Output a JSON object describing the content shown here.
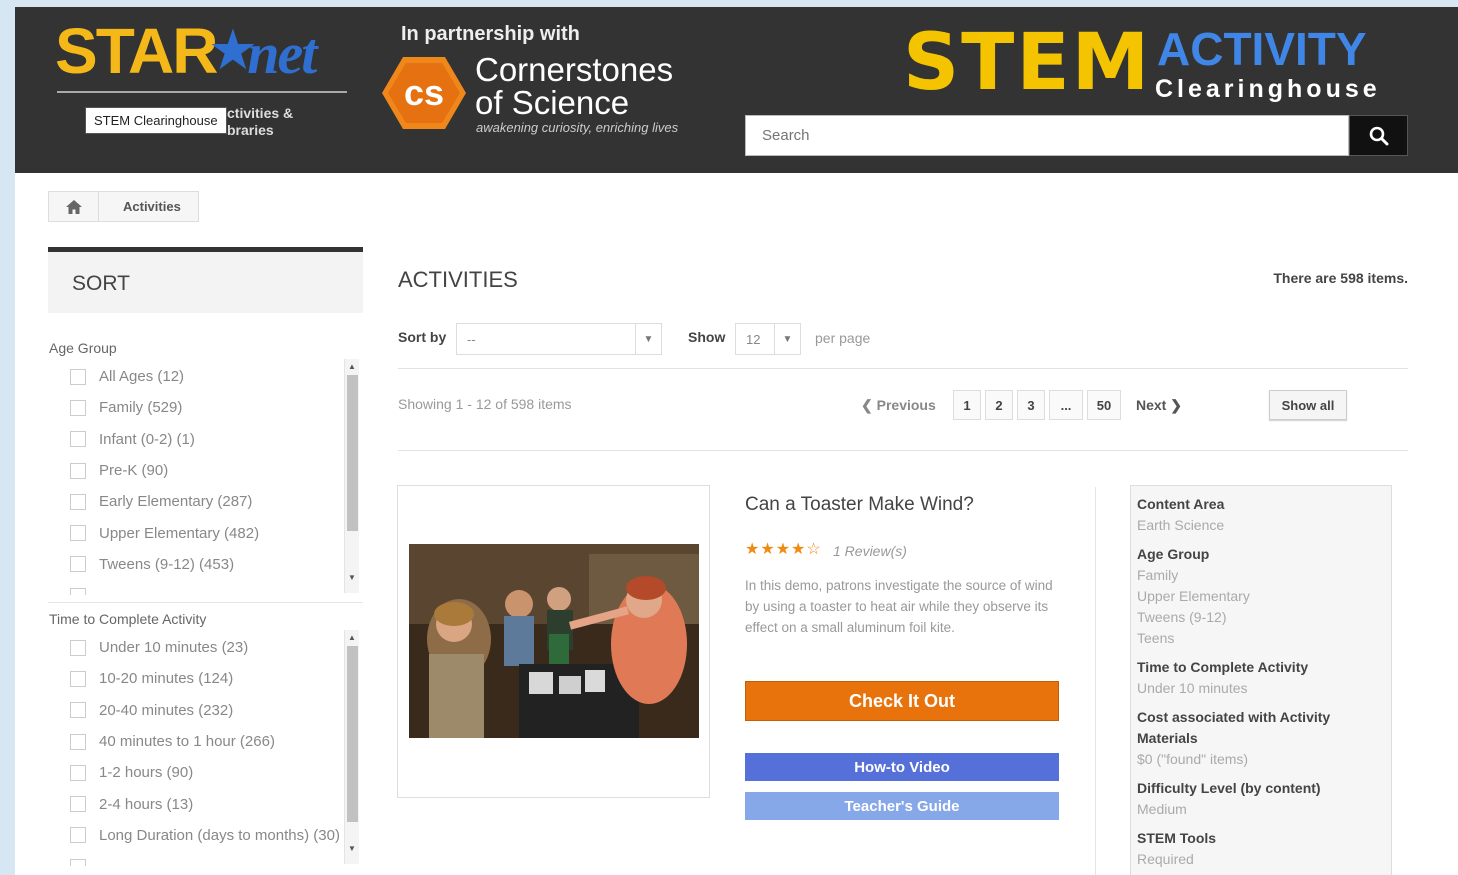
{
  "header": {
    "logo": {
      "star": "STAR",
      "net": "net"
    },
    "tooltip": "STEM Clearinghouse",
    "logo_sub_line1": "ctivities &",
    "logo_sub_line2": "braries",
    "partnership": "In partnership with",
    "cs_badge": "cs",
    "cs_line1": "Cornerstones",
    "cs_line2": "of Science",
    "cs_tagline": "awakening curiosity, enriching lives",
    "stem": "STEM",
    "activity": "ACTIVITY",
    "clearinghouse": "Clearinghouse",
    "search_placeholder": "Search"
  },
  "breadcrumb": {
    "label": "Activities"
  },
  "sort_panel": {
    "title": "SORT"
  },
  "facets": {
    "age_group": {
      "title": "Age Group",
      "items": [
        "All Ages (12)",
        "Family (529)",
        "Infant (0-2) (1)",
        "Pre-K (90)",
        "Early Elementary (287)",
        "Upper Elementary (482)",
        "Tweens (9-12) (453)"
      ]
    },
    "time": {
      "title": "Time to Complete Activity",
      "items": [
        "Under 10 minutes (23)",
        "10-20 minutes (124)",
        "20-40 minutes (232)",
        "40 minutes to 1 hour (266)",
        "1-2 hours (90)",
        "2-4 hours (13)",
        "Long Duration (days to months) (30)"
      ]
    }
  },
  "main": {
    "title": "ACTIVITIES",
    "items_count": "There are 598 items.",
    "sort_by_label": "Sort by",
    "sort_by_value": "--",
    "show_label": "Show",
    "show_value": "12",
    "per_page": "per page",
    "showing": "Showing 1 - 12 of 598 items",
    "previous": "Previous",
    "pages": [
      "1",
      "2",
      "3",
      "...",
      "50"
    ],
    "next": "Next",
    "show_all": "Show all"
  },
  "product": {
    "title": "Can a Toaster Make Wind?",
    "rating": 4,
    "stars": "★★★★☆",
    "reviews": "1 Review(s)",
    "description": "In this demo, patrons investigate the source of wind by using a toaster to heat air while they observe its effect on a small aluminum foil kite.",
    "check_label": "Check It Out",
    "video_label": "How-to Video",
    "guide_label": "Teacher's Guide"
  },
  "attributes": [
    {
      "heading": "Content Area",
      "values": [
        "Earth Science"
      ]
    },
    {
      "heading": "Age Group",
      "values": [
        "Family",
        "Upper Elementary",
        "Tweens (9-12)",
        "Teens"
      ]
    },
    {
      "heading": "Time to Complete Activity",
      "values": [
        "Under 10 minutes"
      ]
    },
    {
      "heading": "Cost associated with Activity Materials",
      "values": [
        "$0 (\"found\" items)"
      ]
    },
    {
      "heading": "Difficulty Level (by content)",
      "values": [
        "Medium"
      ]
    },
    {
      "heading": "STEM Tools",
      "values": [
        "Required"
      ]
    }
  ],
  "colors": {
    "header_bg": "#333333",
    "star_yellow": "#f5b819",
    "net_blue": "#2f6fd1",
    "check_orange": "#e8730c",
    "video_blue": "#5570d8",
    "guide_blue": "#86a7e8"
  }
}
